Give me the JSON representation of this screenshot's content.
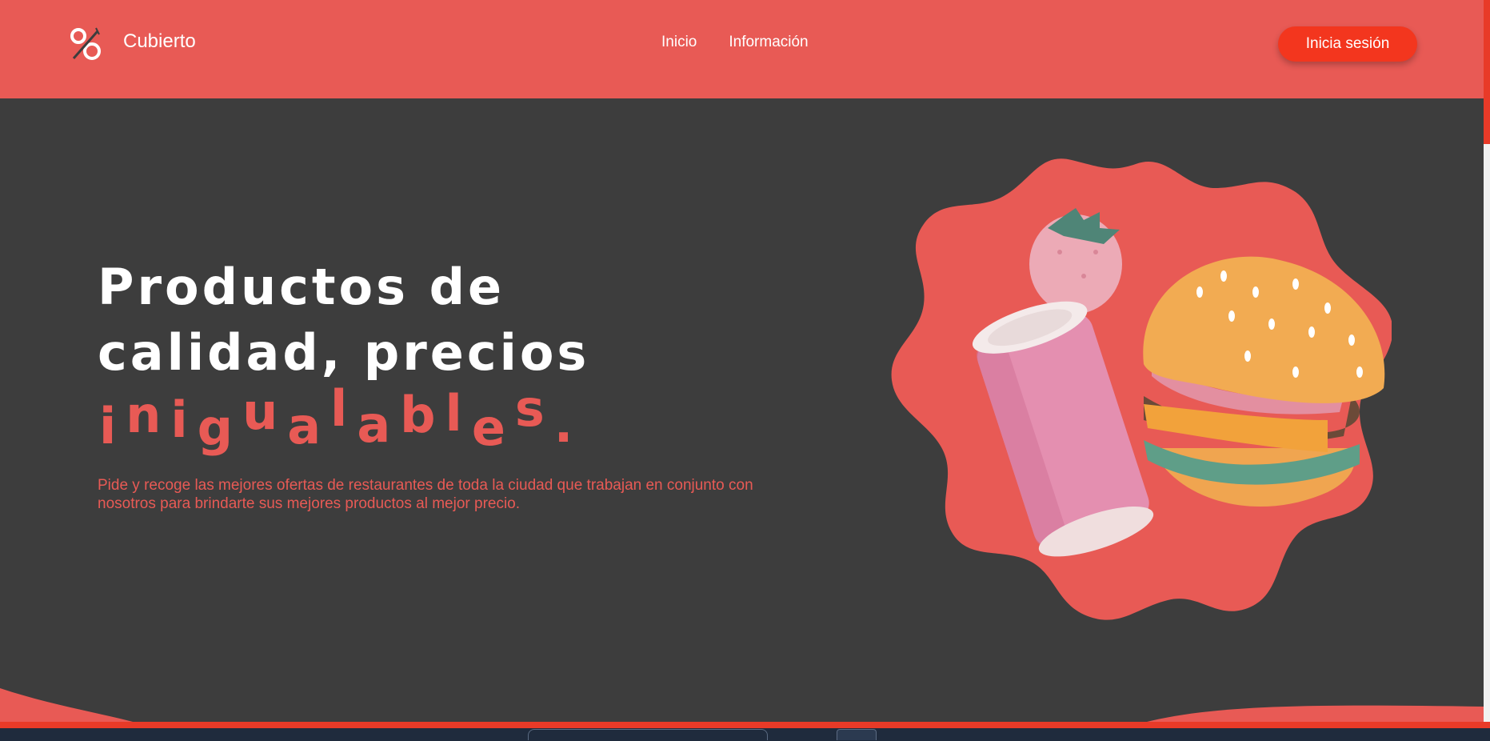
{
  "app": {
    "brand": "Cubierto",
    "colors": {
      "accent": "#e85a55",
      "button": "#f3361e",
      "background": "#3d3d3d"
    }
  },
  "nav": {
    "links": [
      "Inicio",
      "Información"
    ],
    "login_label": "Inicia sesión"
  },
  "hero": {
    "title_line1": "Productos de",
    "title_line2": "calidad, precios",
    "accent_letters": [
      "i",
      "n",
      "i",
      "g",
      "u",
      "a",
      "l",
      "a",
      "b",
      "l",
      "e",
      "s",
      "."
    ],
    "description": "Pide y recoge las mejores ofertas de restaurantes de toda la ciudad que trabajan en conjunto con nosotros para brindarte sus mejores productos al mejor precio."
  },
  "icons": {
    "logo": "fork-knife-percent-icon",
    "hero": "burger-soda-strawberry-illustration"
  }
}
